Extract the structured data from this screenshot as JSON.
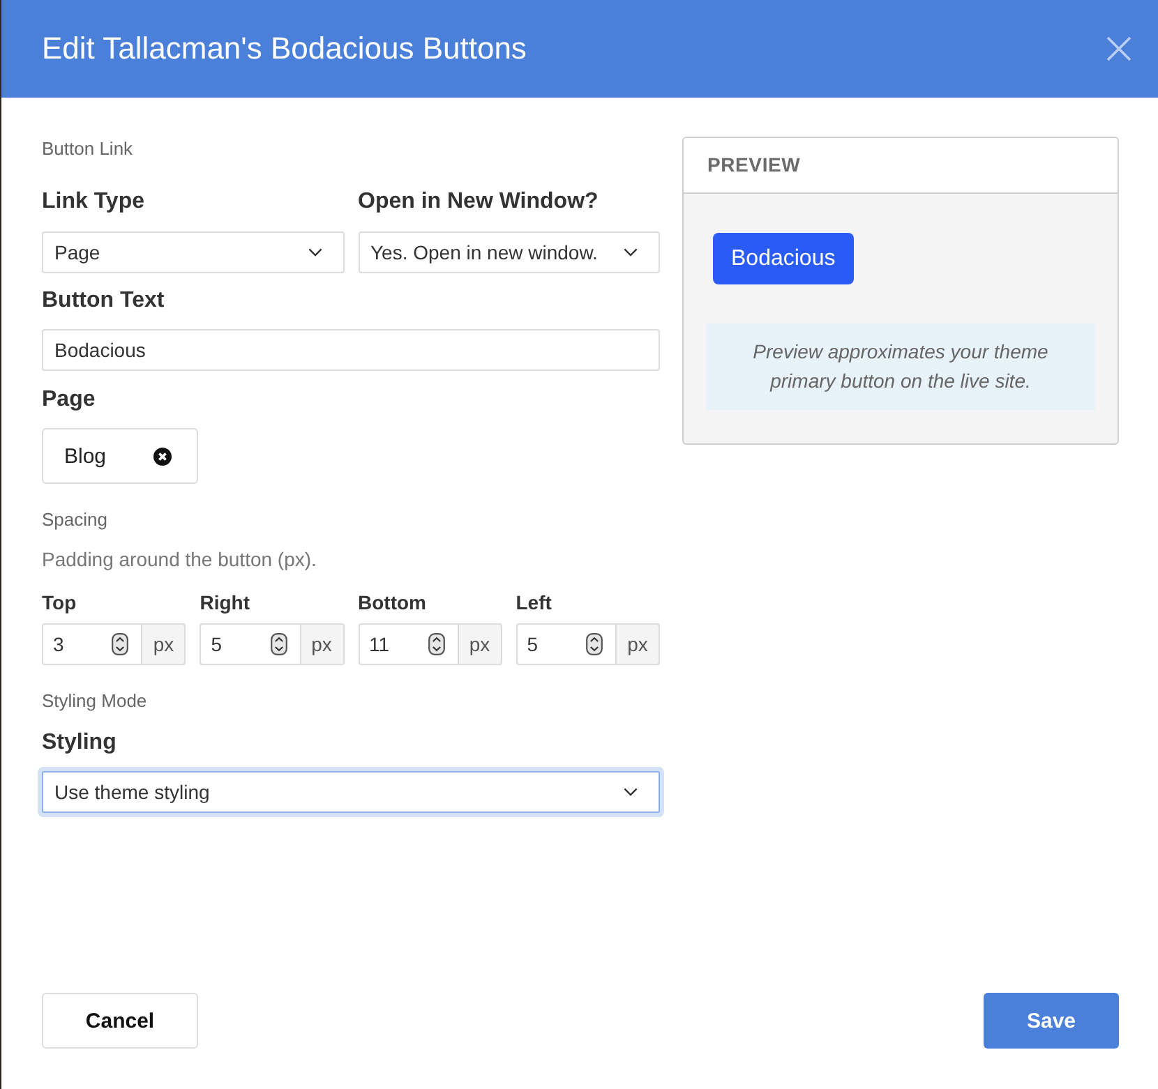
{
  "dialog": {
    "title": "Edit Tallacman's Bodacious Buttons"
  },
  "button_link": {
    "heading": "Button Link",
    "link_type": {
      "label": "Link Type",
      "value": "Page",
      "focused": false
    },
    "new_window": {
      "label": "Open in New Window?",
      "value": "Yes. Open in new window.",
      "focused": false
    },
    "button_text": {
      "label": "Button Text",
      "value": "Bodacious"
    },
    "page": {
      "label": "Page",
      "chips": [
        {
          "label": "Blog"
        }
      ]
    }
  },
  "spacing": {
    "heading": "Spacing",
    "description": "Padding around the button (px).",
    "fields": [
      {
        "label": "Top",
        "value": "3",
        "unit": "px"
      },
      {
        "label": "Right",
        "value": "5",
        "unit": "px"
      },
      {
        "label": "Bottom",
        "value": "11",
        "unit": "px"
      },
      {
        "label": "Left",
        "value": "5",
        "unit": "px"
      }
    ]
  },
  "styling_mode": {
    "heading": "Styling Mode",
    "styling": {
      "label": "Styling",
      "value": "Use theme styling",
      "focused": true
    }
  },
  "preview": {
    "title": "PREVIEW",
    "button": "Bodacious",
    "note": "Preview approximates your theme primary button on the live site."
  },
  "footer": {
    "buttons": [
      {
        "label": "Cancel",
        "kind": "secondary"
      },
      {
        "label": "Save",
        "kind": "primary"
      }
    ]
  }
}
